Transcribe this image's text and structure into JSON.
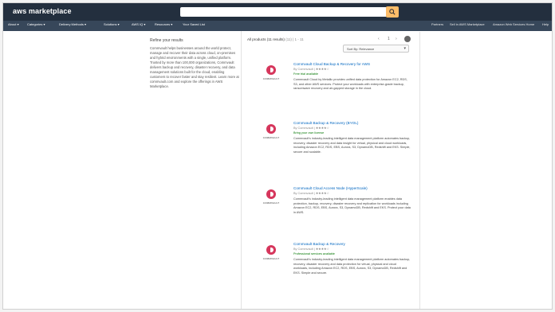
{
  "header": {
    "logo_text": "aws marketplace",
    "search_placeholder": ""
  },
  "nav": {
    "left": [
      "About ▾",
      "Categories ▾",
      "Delivery Methods ▾",
      "Solutions ▾",
      "AWS IQ ▾",
      "Resources ▾",
      "Your Saved List"
    ],
    "right": [
      "Partners",
      "Sell in AWS Marketplace",
      "Amazon Web Services Home",
      "Help"
    ]
  },
  "sidebar": {
    "title": "Refine your results",
    "text": "Commvault helps businesses around the world protect, manage and recover their data across cloud, on-premises and hybrid environments with a single, unified platform. Trusted by more than 100,000 organizations, Commvault delivers backup and recovery, disaster recovery, and data management solutions built for the cloud, enabling customers to recover faster and stay resilient. Learn more at commvault.com and explore the offerings in AWS Marketplace."
  },
  "results": {
    "heading": "All products (11 results)",
    "count_label": "(11) | 1 - 11",
    "sort_label": "Sort By: Relevance",
    "pager_prev": "‹",
    "pager_page": "1",
    "pager_next": "›"
  },
  "cards": [
    {
      "title": "Commvault Cloud Backup & Recovery for AWS",
      "meta": "By Commvault | ★★★★☆",
      "free": "Free trial available",
      "desc": "Commvault Cloud by Metallic provides unified data protection for Amazon EC2, RDS, S3, and other AWS services. Protect your workloads with enterprise-grade backup, ransomware recovery and air-gapped storage in the cloud."
    },
    {
      "title": "Commvault Backup & Recovery (BYOL)",
      "meta": "By Commvault | ★★★★☆",
      "free": "Bring your own license",
      "desc": "Commvault's industry-leading intelligent data management platform automates backup, recovery, disaster recovery and data insight for virtual, physical and cloud workloads, including Amazon EC2, RDS, EBS, Aurora, S3, DynamoDB, Redshift and EKS. Simple, secure and scalable."
    },
    {
      "title": "Commvault Cloud Access Node (HyperScale)",
      "meta": "By Commvault | ★★★★☆",
      "free": "",
      "desc": "Commvault's industry-leading intelligent data management platform enables data protection, backup, recovery, disaster recovery and replication for workloads including Amazon EC2, RDS, EBS, Aurora, S3, DynamoDB, Redshift and EKS. Protect your data in AWS."
    },
    {
      "title": "Commvault Backup & Recovery",
      "meta": "By Commvault | ★★★★☆",
      "free": "Professional services available",
      "desc": "Commvault's industry-leading intelligent data management platform automates backup, recovery, disaster recovery and data protection for virtual, physical and cloud workloads, including Amazon EC2, RDS, EBS, Aurora, S3, DynamoDB, Redshift and EKS. Simple and secure."
    }
  ],
  "card_brand": "COMMVAULT",
  "colors": {
    "topbar": "#232f3e",
    "navbar": "#37475a",
    "accent": "#ff9900",
    "link": "#0066c0",
    "brand_logo": "#d6365c"
  }
}
